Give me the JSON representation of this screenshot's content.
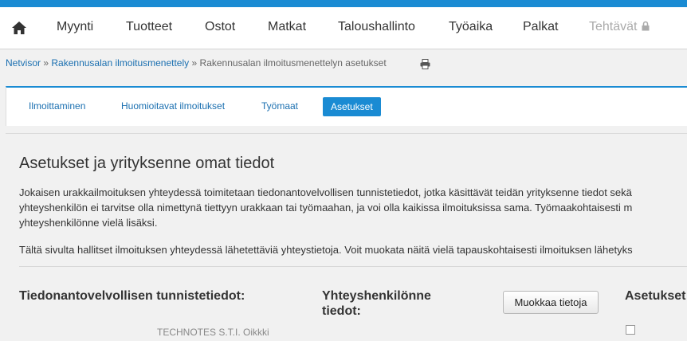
{
  "nav": {
    "items": [
      "Myynti",
      "Tuotteet",
      "Ostot",
      "Matkat",
      "Taloushallinto",
      "Työaika",
      "Palkat"
    ],
    "disabled_item": "Tehtävät"
  },
  "breadcrumb": {
    "items": [
      "Netvisor",
      "Rakennusalan ilmoitusmenettely",
      "Rakennusalan ilmoitusmenettelyn asetukset"
    ],
    "separator": "»"
  },
  "tabs": [
    {
      "label": "Ilmoittaminen",
      "active": false
    },
    {
      "label": "Huomioitavat ilmoitukset",
      "active": false
    },
    {
      "label": "Työmaat",
      "active": false
    },
    {
      "label": "Asetukset",
      "active": true
    }
  ],
  "main": {
    "title": "Asetukset ja yrityksenne omat tiedot",
    "intro_lines": [
      "Jokaisen urakkailmoituksen yhteydessä toimitetaan tiedonantovelvollisen tunnistetiedot, jotka käsittävät teidän yrityksenne tiedot sekä",
      "yhteyshenkilön ei tarvitse olla nimettynä tiettyyn urakkaan tai työmaahan, ja voi olla kaikissa ilmoituksissa sama. Työmaakohtaisesti m",
      "yhteyshenkilönne vielä lisäksi."
    ],
    "note": "Tältä sivulta hallitset ilmoituksen yhteydessä lähetettäviä yhteystietoja. Voit muokata näitä vielä tapauskohtaisesti ilmoituksen lähetyks",
    "section1_heading": "Tiedonantovelvollisen tunnistetiedot:",
    "section2_heading_line1": "Yhteyshenkilönne",
    "section2_heading_line2": "tiedot:",
    "edit_button": "Muokkaa tietoja",
    "section3_heading": "Asetukset",
    "partial_text": "TECHNOTES S.T.I. Oikkki"
  },
  "colors": {
    "accent": "#1a8bd3",
    "link": "#1a6fb0"
  }
}
